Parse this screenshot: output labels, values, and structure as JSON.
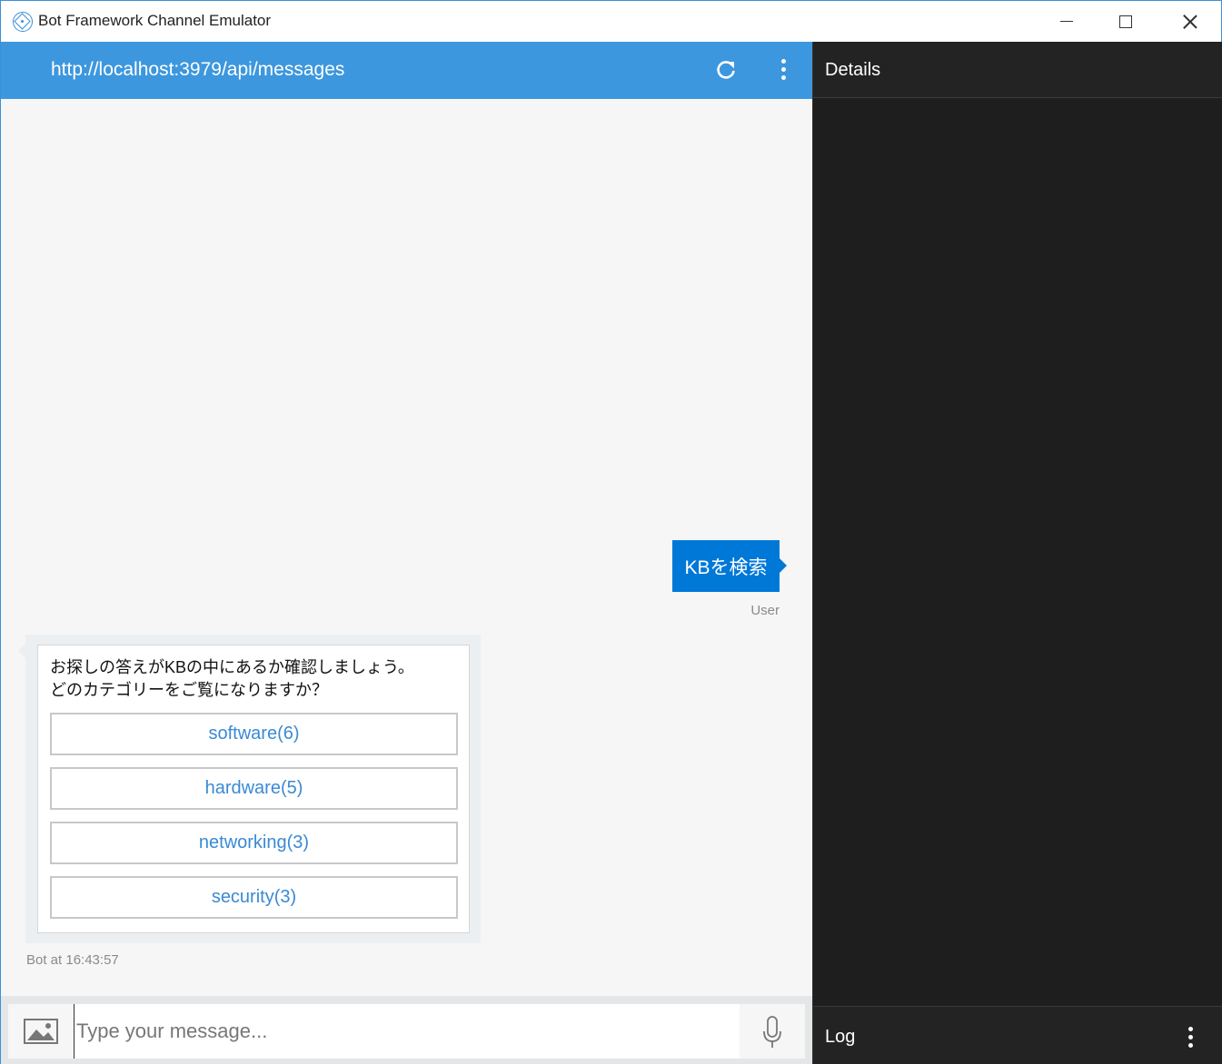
{
  "window": {
    "title": "Bot Framework Channel Emulator"
  },
  "chat": {
    "address": "http://localhost:3979/api/messages",
    "user_message": "KBを検索",
    "user_from": "User",
    "bot_lines": [
      "お探しの答えがKBの中にあるか確認しましょう。",
      "どのカテゴリーをご覧になりますか？"
    ],
    "buttons": [
      "software(6)",
      "hardware(5)",
      "networking(3)",
      "security(3)"
    ],
    "bot_from": "Bot at 16:43:57",
    "input_placeholder": "Type your message..."
  },
  "details": {
    "title": "Details",
    "log_title": "Log"
  },
  "colors": {
    "address_bar": "#3c97de",
    "user_bubble": "#0078d7",
    "card_button_text": "#3a8ad4",
    "details_bg": "#1e1e1e"
  },
  "icons": [
    "app-icon",
    "refresh-icon",
    "more-vertical-icon",
    "image-icon",
    "microphone-icon"
  ]
}
